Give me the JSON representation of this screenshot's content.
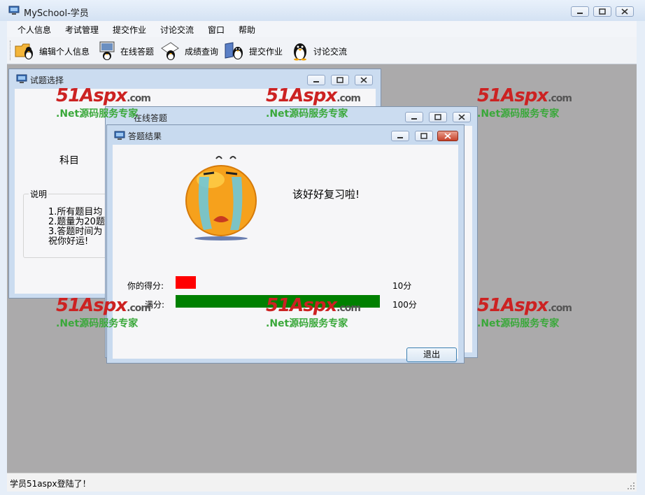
{
  "app": {
    "title": "MySchool-学员"
  },
  "menu": [
    "个人信息",
    "考试管理",
    "提交作业",
    "讨论交流",
    "窗口",
    "帮助"
  ],
  "toolbar": {
    "items": [
      {
        "label": "编辑个人信息",
        "icon": "folder-penguin-icon"
      },
      {
        "label": "在线答题",
        "icon": "computer-penguin-icon"
      },
      {
        "label": "成绩查询",
        "icon": "paper-penguin-icon"
      },
      {
        "label": "提交作业",
        "icon": "book-penguin-icon"
      },
      {
        "label": "讨论交流",
        "icon": "penguin-icon"
      }
    ]
  },
  "windows": {
    "select": {
      "title": "试题选择",
      "subject_label": "科目",
      "desc_label": "说明",
      "desc_lines": [
        "1.所有题目均",
        "2.题量为20题",
        "3.答题时间为",
        "祝你好运!"
      ]
    },
    "online": {
      "title": "在线答题"
    },
    "result": {
      "title": "答题结果",
      "message": "该好好复习啦!",
      "score_label": "你的得分:",
      "score_value": "10分",
      "full_label": "满分:",
      "full_value": "100分",
      "score_fraction": 0.1,
      "exit_label": "退出",
      "score_color": "#ff0000",
      "full_color": "#008000"
    }
  },
  "watermark": {
    "logo": "51Aspx",
    "logo_suffix": ".com",
    "sub": ".Net源码服务专家"
  },
  "status": {
    "text": "学员51aspx登陆了！"
  }
}
